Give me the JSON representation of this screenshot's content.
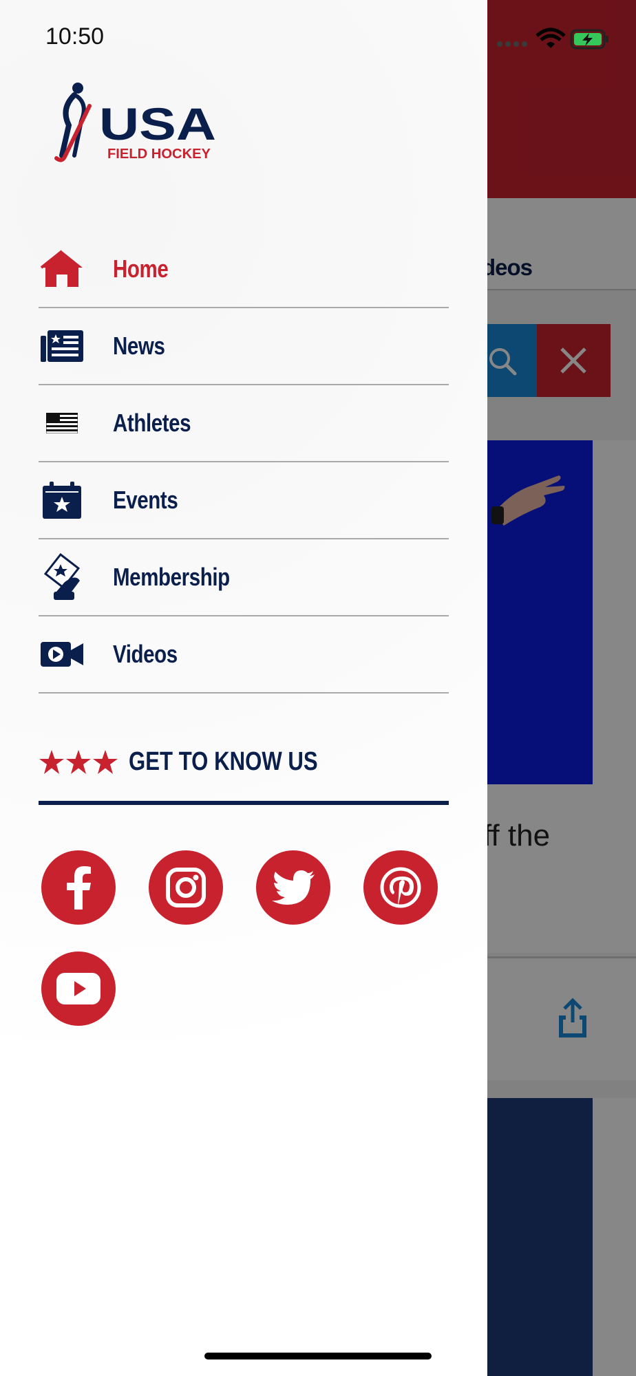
{
  "status_bar": {
    "time": "10:50"
  },
  "brand": {
    "name": "USA FIELD HOCKEY",
    "primary": "#0b1f4d",
    "accent": "#c8222f"
  },
  "background": {
    "tab_label_partial": "deos",
    "card_text_partial": "ff the"
  },
  "menu": {
    "items": [
      {
        "label": "Home",
        "icon": "home-icon",
        "active": true
      },
      {
        "label": "News",
        "icon": "news-icon",
        "active": false
      },
      {
        "label": "Athletes",
        "icon": "flag-icon",
        "active": false
      },
      {
        "label": "Events",
        "icon": "calendar-star-icon",
        "active": false
      },
      {
        "label": "Membership",
        "icon": "membership-card-icon",
        "active": false
      },
      {
        "label": "Videos",
        "icon": "video-camera-icon",
        "active": false
      }
    ]
  },
  "get_to_know": {
    "label": "GET TO KNOW US"
  },
  "social": [
    {
      "name": "facebook"
    },
    {
      "name": "instagram"
    },
    {
      "name": "twitter"
    },
    {
      "name": "pinterest"
    },
    {
      "name": "youtube"
    }
  ]
}
